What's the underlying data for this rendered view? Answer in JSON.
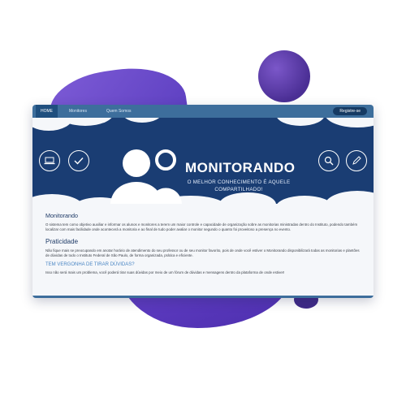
{
  "nav": {
    "items": [
      "HOME",
      "Monitores",
      "Quem Somos"
    ],
    "register_label": "Registre-se"
  },
  "banner": {
    "title": "MONITORANDO",
    "subtitle": "O MELHOR CONHECIMENTO É AQUELE COMPARTILHADO!",
    "icons": [
      "laptop-icon",
      "check-icon",
      "search-icon",
      "pencil-icon",
      "users-logo"
    ]
  },
  "sections": [
    {
      "heading": "Monitorando",
      "text": "O sistema tem como objetivo auxiliar e informar os alunos e monitores a terem um maior controle e capacidade de organização sobre as monitorias ministradas dentro do Instituto, podendo também localizar com mais facilidade onde acontecerá a monitoria e ao final de tudo poder avaliar o monitor segundo o quanto foi proveitoso a presença no evento."
    },
    {
      "heading": "Praticidade",
      "text": "Não fique mais se preocupando em anotar horário de atendimento do seu professor ou de seu monitor favorito, pois de onde você estiver o Monitorando disponibilizará todas as monitorias e plantões de dúvidas de todo o Instituto Federal de São Paulo, de forma organizada, prática e eficiente."
    },
    {
      "heading": "TEM VERGONHA DE TIRAR DÚVIDAS?",
      "text": "Isso não será mais um problema, você poderá tirar suas dúvidas por meio de um fórum de dúvidas e mensagens dentro da plataforma de onde estiver!"
    }
  ],
  "colors": {
    "banner_bg": "#1a3d73",
    "nav_bg": "#3d6e9c",
    "accent_purple": "#5a3dbf",
    "heading": "#1e3a66",
    "link": "#4a86c4"
  }
}
